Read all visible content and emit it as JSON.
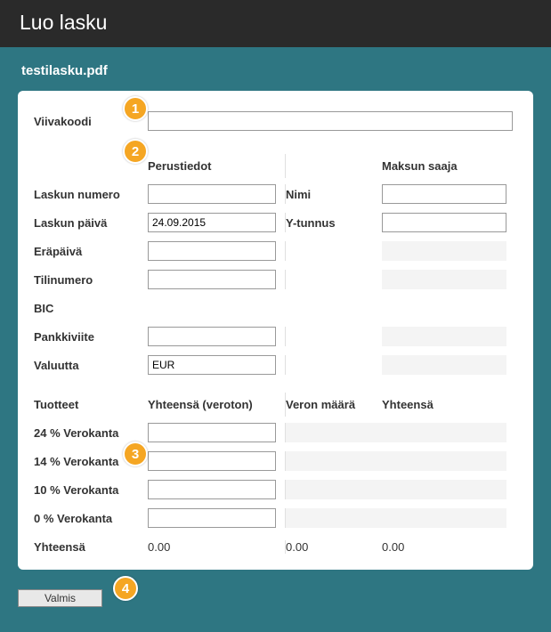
{
  "title": "Luo lasku",
  "filename": "testilasku.pdf",
  "barcode": {
    "label": "Viivakoodi",
    "value": ""
  },
  "basic": {
    "header": "Perustiedot",
    "number_label": "Laskun numero",
    "number_value": "",
    "date_label": "Laskun päivä",
    "date_value": "24.09.2015",
    "due_label": "Eräpäivä",
    "due_value": "",
    "account_label": "Tilinumero",
    "account_value": "",
    "bic_label": "BIC",
    "ref_label": "Pankkiviite",
    "ref_value": "",
    "currency_label": "Valuutta",
    "currency_value": "EUR"
  },
  "payee": {
    "header": "Maksun saaja",
    "name_label": "Nimi",
    "name_value": "",
    "vatid_label": "Y-tunnus",
    "vatid_value": ""
  },
  "products": {
    "header_left": "Tuotteet",
    "header_subtotal": "Yhteensä (veroton)",
    "header_tax": "Veron määrä",
    "header_total": "Yhteensä",
    "rate24_label": "24 % Verokanta",
    "rate14_label": "14 % Verokanta",
    "rate10_label": "10 % Verokanta",
    "rate0_label": "0 % Verokanta",
    "totals_label": "Yhteensä",
    "totals_net": "0.00",
    "totals_tax": "0.00",
    "totals_gross": "0.00"
  },
  "badges": {
    "b1": "1",
    "b2": "2",
    "b3": "3",
    "b4": "4"
  },
  "buttons": {
    "finish": "Valmis"
  }
}
